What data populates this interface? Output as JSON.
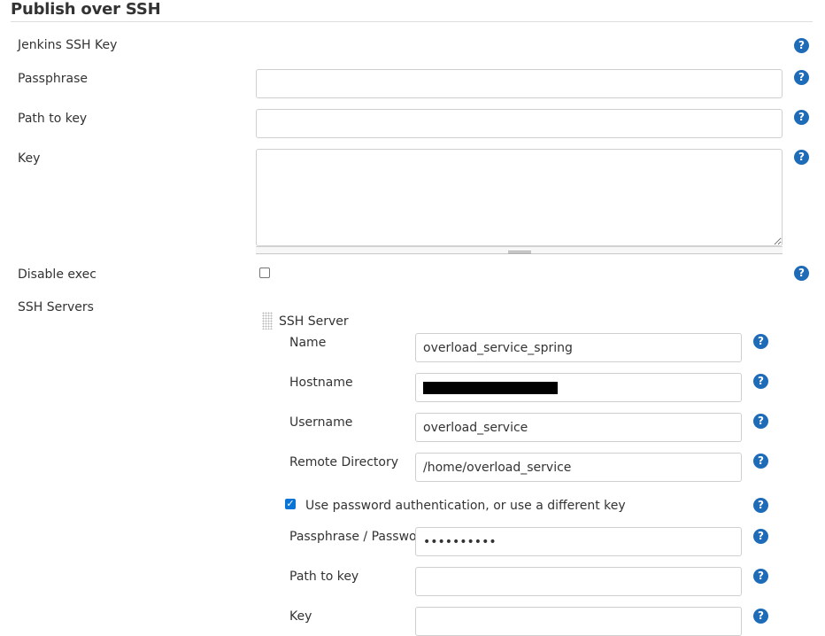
{
  "section": {
    "title": "Publish over SSH"
  },
  "global": {
    "jenkins_ssh_key_label": "Jenkins SSH Key",
    "passphrase": {
      "label": "Passphrase",
      "value": ""
    },
    "path_to_key": {
      "label": "Path to key",
      "value": ""
    },
    "key": {
      "label": "Key",
      "value": ""
    },
    "disable_exec": {
      "label": "Disable exec",
      "checked": false
    },
    "ssh_servers_label": "SSH Servers"
  },
  "ssh_server": {
    "header": "SSH Server",
    "name": {
      "label": "Name",
      "value": "overload_service_spring"
    },
    "hostname": {
      "label": "Hostname",
      "value": ""
    },
    "username": {
      "label": "Username",
      "value": "overload_service"
    },
    "remote_directory": {
      "label": "Remote Directory",
      "value": "/home/overload_service"
    },
    "use_password_auth": {
      "label": "Use password authentication, or use a different key",
      "checked": true
    },
    "passphrase_password": {
      "label": "Passphrase / Password",
      "value": "••••••••••"
    },
    "path_to_key": {
      "label": "Path to key",
      "value": ""
    },
    "key": {
      "label": "Key",
      "value": ""
    }
  },
  "icons": {
    "help": "help-icon",
    "help_glyph": "?"
  },
  "colors": {
    "help_blue": "#1e6bb8",
    "checkbox_blue": "#0b74d7"
  }
}
